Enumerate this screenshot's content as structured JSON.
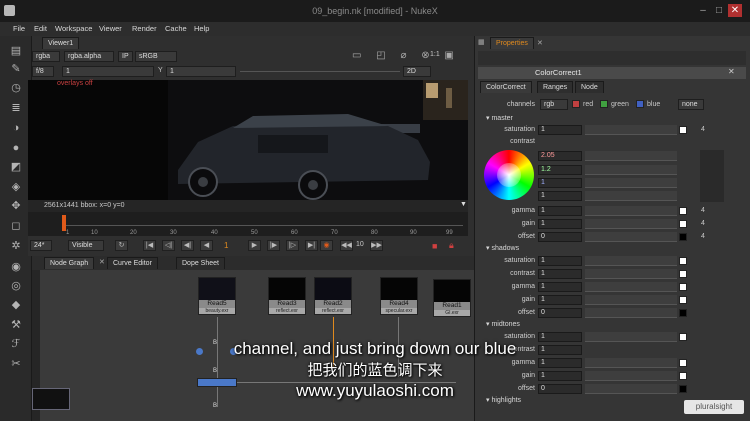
{
  "window": {
    "title": "09_begin.nk [modified] - NukeX"
  },
  "menu": [
    "File",
    "Edit",
    "Workspace",
    "Viewer",
    "Render",
    "Cache",
    "Help"
  ],
  "viewer": {
    "tab": "Viewer1",
    "channels": "rgba",
    "alpha": "rgba.alpha",
    "ip": "IP",
    "colorspace": "sRGB",
    "fstop": "f/8",
    "frame_field": "1",
    "y_label": "Y",
    "y_value": "1",
    "view_mode": "2D",
    "zoom": "1:1",
    "overlay_text": "overlays off",
    "info": "2561x1441  bbox: x=0 y=0",
    "fps": "24*",
    "visible": "Visible",
    "frame": "1",
    "step": "10"
  },
  "timeline": {
    "ticks": [
      "1",
      "10",
      "20",
      "30",
      "40",
      "50",
      "60",
      "70",
      "80",
      "90",
      "99"
    ]
  },
  "panels": {
    "node_graph": "Node Graph",
    "curve_editor": "Curve Editor",
    "dope_sheet": "Dope Sheet"
  },
  "nodes": [
    {
      "name": "Read5",
      "file": "beauty.exr"
    },
    {
      "name": "Read3",
      "file": "reflect.exr"
    },
    {
      "name": "Read2",
      "file": "reflect.exr"
    },
    {
      "name": "Read4",
      "file": "specular.exr"
    },
    {
      "name": "Read1",
      "file": "GI.exr"
    }
  ],
  "node_input_label": "B",
  "properties": {
    "title": "Properties",
    "node_name": "ColorCorrect1",
    "tabs": [
      "ColorCorrect",
      "Ranges",
      "Node"
    ],
    "channels_label": "channels",
    "channels_value": "rgb",
    "ch_red": "red",
    "ch_green": "green",
    "ch_blue": "blue",
    "ch_none": "none",
    "master": {
      "label": "master",
      "saturation": "1",
      "gain_r": "2.05",
      "gain_g": "1.2",
      "gain_b": "1",
      "gain_a": "1",
      "gamma": "1",
      "gain": "1",
      "offset": "0"
    },
    "shadows": {
      "label": "shadows",
      "saturation": "1",
      "contrast": "1",
      "gamma": "1",
      "gain": "1",
      "offset": "0"
    },
    "midtones": {
      "label": "midtones",
      "saturation": "1",
      "contrast": "1",
      "gamma": "1",
      "gain": "1",
      "offset": "0"
    },
    "highlights": {
      "label": "highlights"
    },
    "row_labels": {
      "saturation": "saturation",
      "contrast": "contrast",
      "gamma": "gamma",
      "gain": "gain",
      "offset": "offset"
    },
    "badge": "4"
  },
  "subtitles": {
    "en": "channel, and just bring down our blue",
    "zh": "把我们的蓝色调下来",
    "url": "www.yuyulaoshi.com"
  },
  "watermark": "pluralsight",
  "colors": {
    "accent": "#e08a1e",
    "node_blue": "#4a78c8",
    "timeline_marker": "#e05a1a"
  }
}
